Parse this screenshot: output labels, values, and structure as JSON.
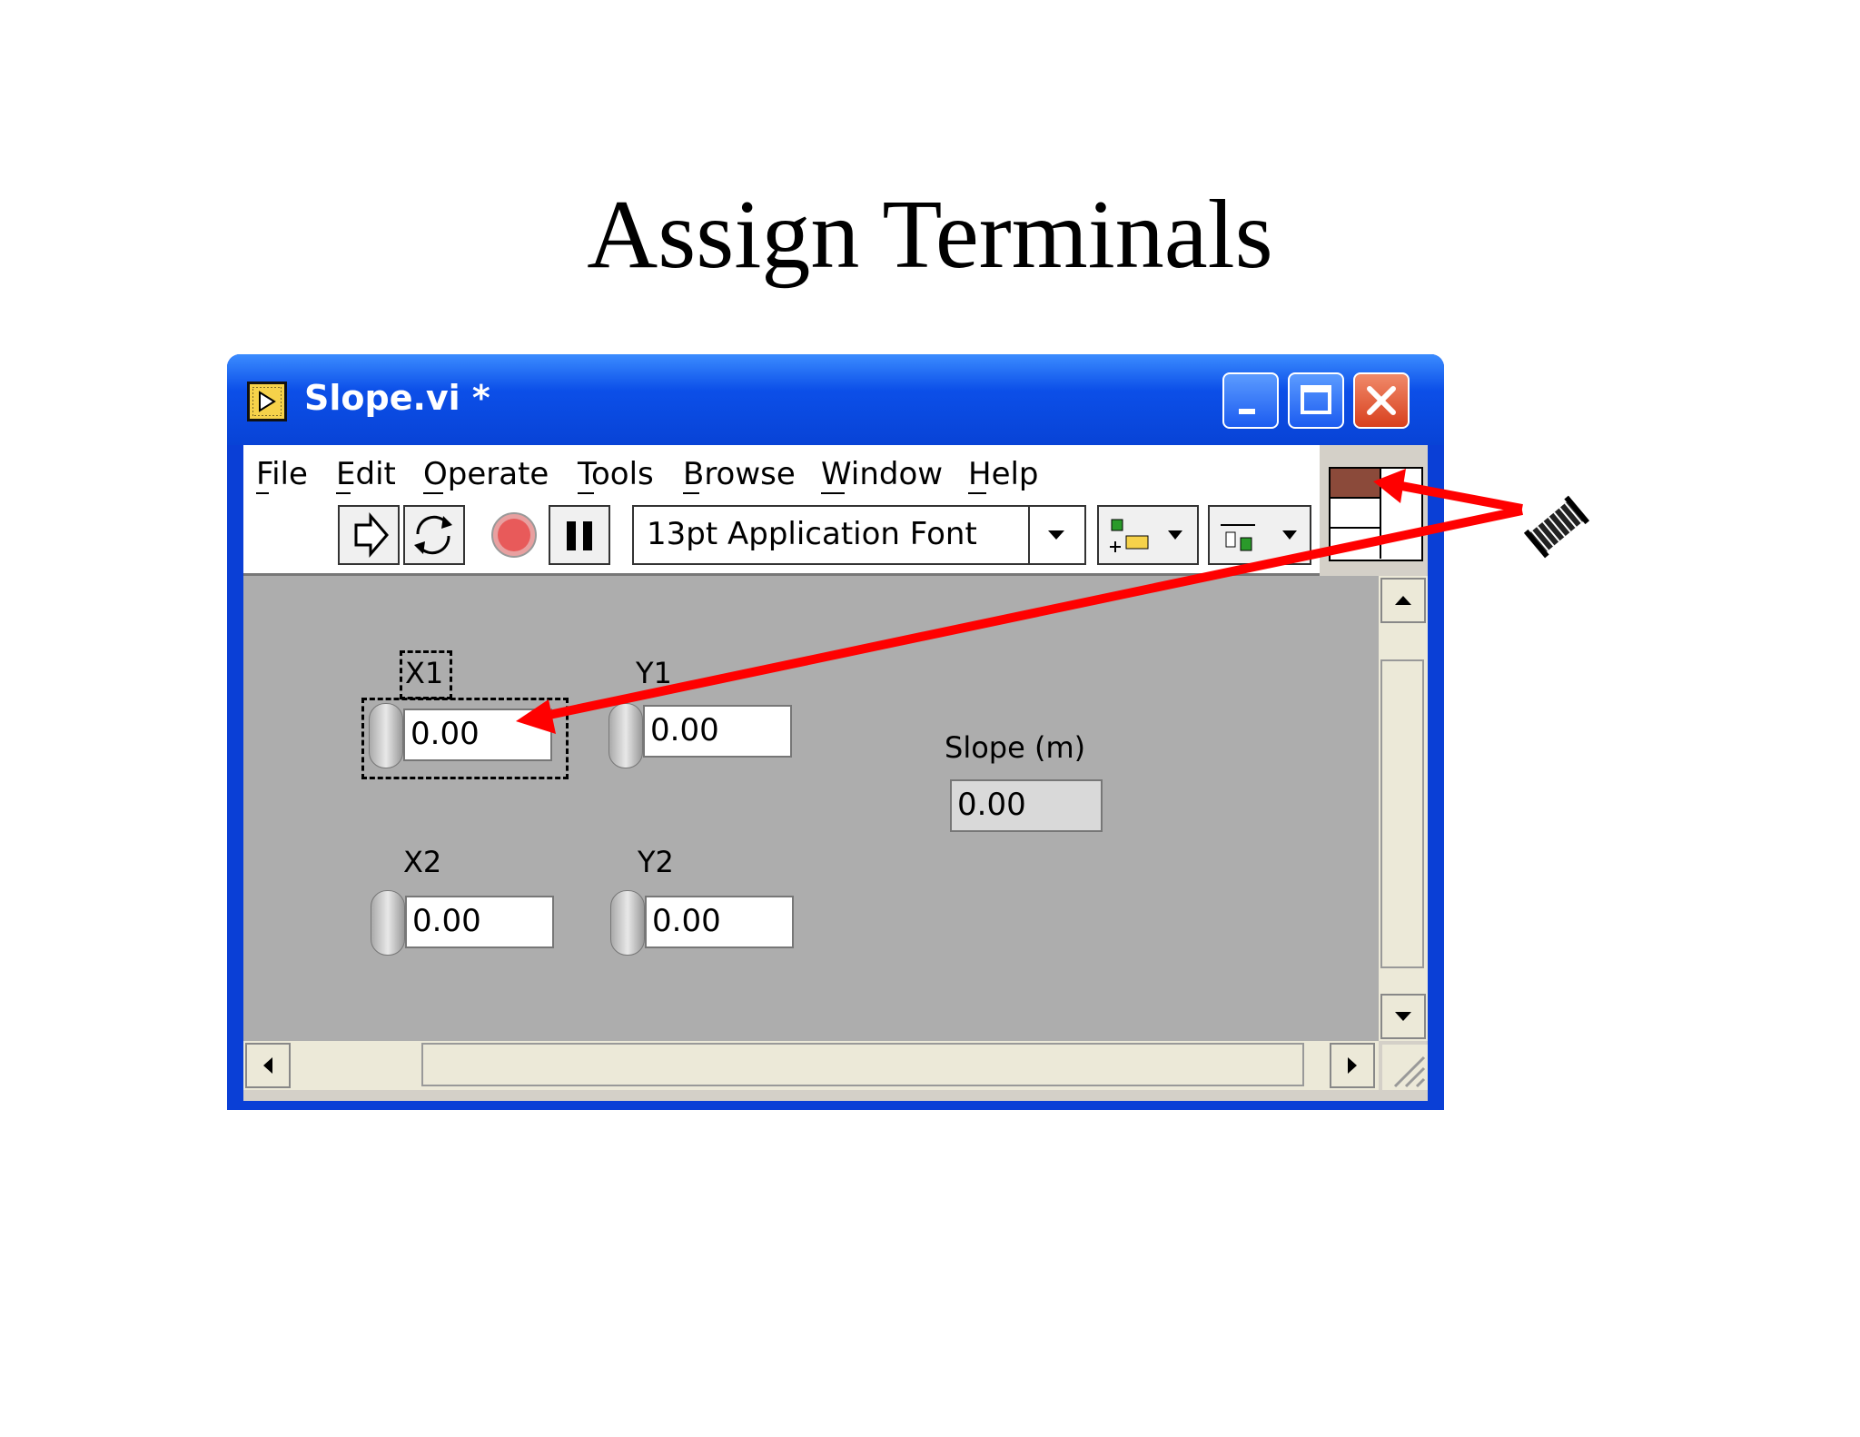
{
  "slide": {
    "title": "Assign Terminals"
  },
  "window": {
    "title": "Slope.vi *",
    "menu": [
      {
        "label": "File",
        "accel": "F"
      },
      {
        "label": "Edit",
        "accel": "E"
      },
      {
        "label": "Operate",
        "accel": "O"
      },
      {
        "label": "Tools",
        "accel": "T"
      },
      {
        "label": "Browse",
        "accel": "B"
      },
      {
        "label": "Window",
        "accel": "W"
      },
      {
        "label": "Help",
        "accel": "H"
      }
    ],
    "toolbar": {
      "font": "13pt Application Font"
    }
  },
  "controls": {
    "x1": {
      "label": "X1",
      "value": "0.00"
    },
    "y1": {
      "label": "Y1",
      "value": "0.00"
    },
    "x2": {
      "label": "X2",
      "value": "0.00"
    },
    "y2": {
      "label": "Y2",
      "value": "0.00"
    }
  },
  "indicators": {
    "slope": {
      "label": "Slope (m)",
      "value": "0.00"
    }
  },
  "colors": {
    "window_blue": "#0a3fd6",
    "panel_gray": "#adadad",
    "arrow_red": "#ff0000",
    "selected_terminal": "#8b4a3a"
  },
  "icons": [
    "labview-vi-icon",
    "minimize-icon",
    "maximize-icon",
    "close-icon",
    "run-arrow-icon",
    "run-continuous-icon",
    "abort-icon",
    "pause-icon",
    "align-icon",
    "distribute-icon",
    "connector-pane-icon",
    "wiring-spool-icon"
  ]
}
